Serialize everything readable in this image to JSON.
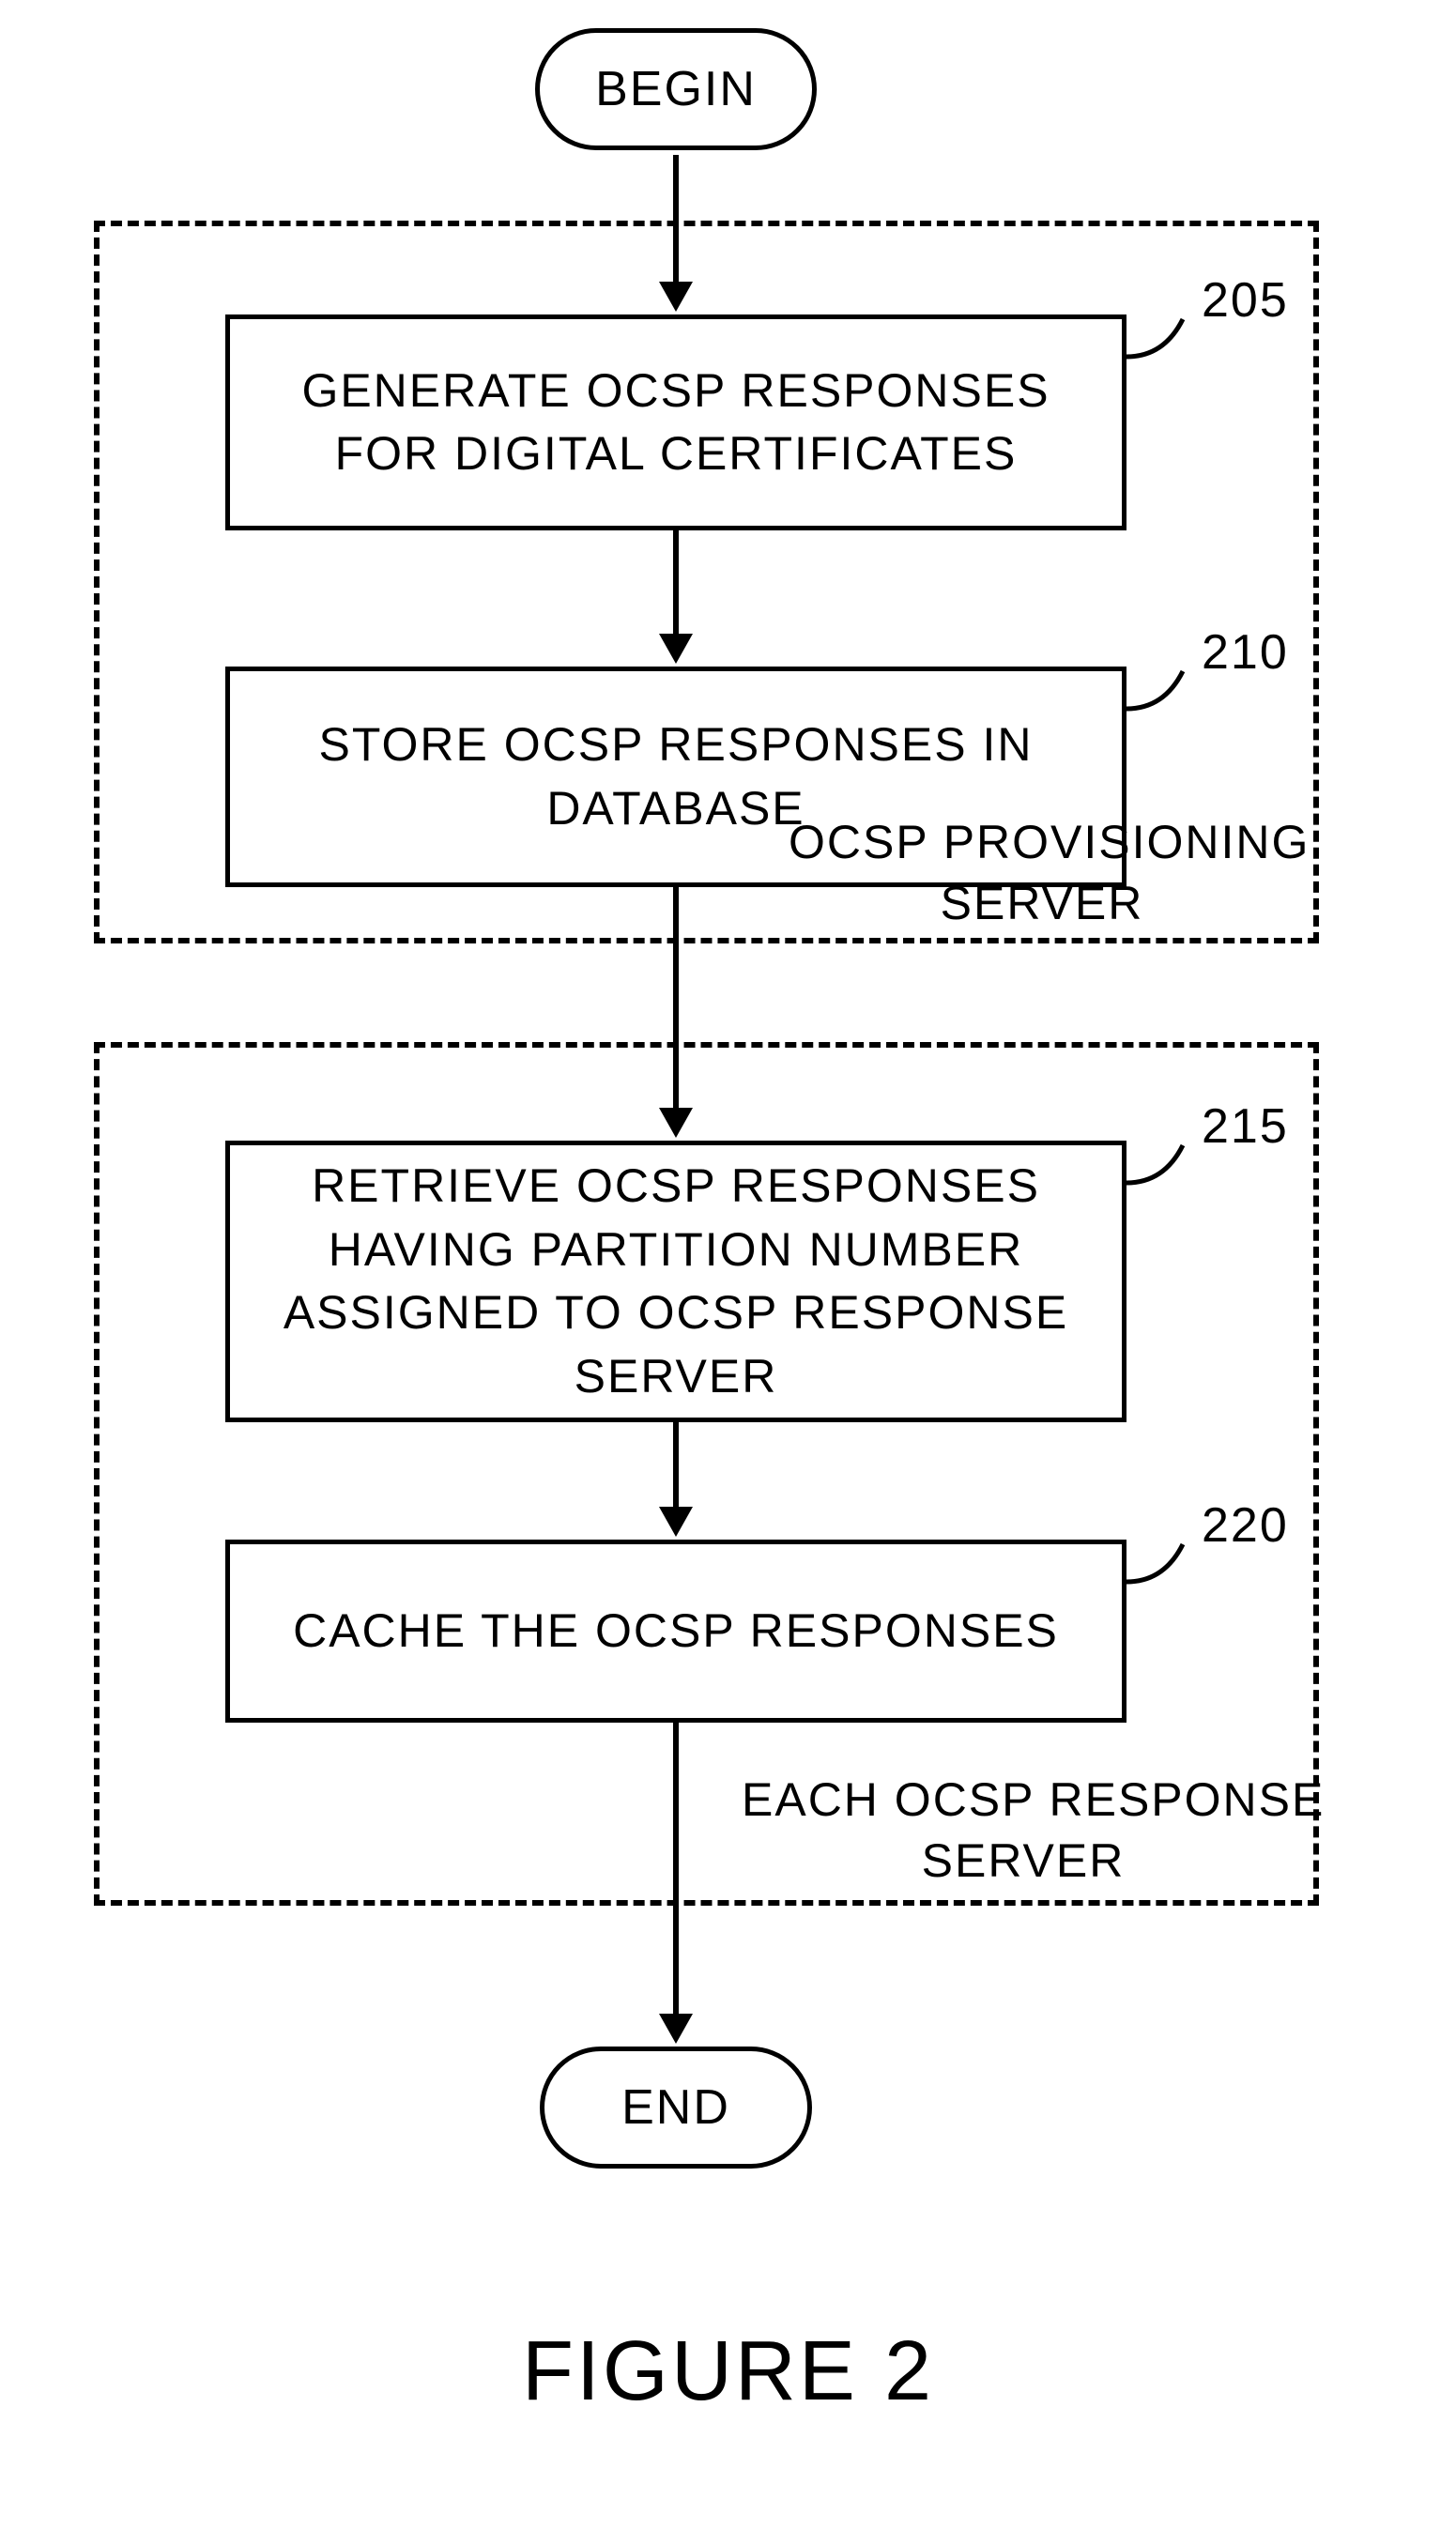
{
  "chart_data": {
    "type": "flowchart",
    "title": "FIGURE 2",
    "nodes": [
      {
        "id": "begin",
        "type": "terminator",
        "label": "BEGIN"
      },
      {
        "id": "205",
        "type": "process",
        "label": "GENERATE OCSP RESPONSES FOR\nDIGITAL CERTIFICATES",
        "ref": "205",
        "group": "provisioning"
      },
      {
        "id": "210",
        "type": "process",
        "label": "STORE OCSP RESPONSES IN\nDATABASE",
        "ref": "210",
        "group": "provisioning"
      },
      {
        "id": "215",
        "type": "process",
        "label": "RETRIEVE OCSP RESPONSES\nHAVING PARTITION NUMBER\nASSIGNED TO OCSP RESPONSE\nSERVER",
        "ref": "215",
        "group": "response"
      },
      {
        "id": "220",
        "type": "process",
        "label": "CACHE THE OCSP RESPONSES",
        "ref": "220",
        "group": "response"
      },
      {
        "id": "end",
        "type": "terminator",
        "label": "END"
      }
    ],
    "edges": [
      [
        "begin",
        "205"
      ],
      [
        "205",
        "210"
      ],
      [
        "210",
        "215"
      ],
      [
        "215",
        "220"
      ],
      [
        "220",
        "end"
      ]
    ],
    "groups": [
      {
        "id": "provisioning",
        "label": "OCSP PROVISIONING\nSERVER"
      },
      {
        "id": "response",
        "label": "EACH OCSP RESPONSE\nSERVER"
      }
    ]
  },
  "terminator": {
    "begin": "BEGIN",
    "end": "END"
  },
  "steps": {
    "s205": {
      "text": "GENERATE OCSP RESPONSES FOR DIGITAL CERTIFICATES",
      "ref": "205"
    },
    "s210": {
      "text": "STORE OCSP RESPONSES IN DATABASE",
      "ref": "210"
    },
    "s215": {
      "text": "RETRIEVE OCSP RESPONSES HAVING PARTITION NUMBER ASSIGNED TO OCSP RESPONSE SERVER",
      "ref": "215"
    },
    "s220": {
      "text": "CACHE THE OCSP RESPONSES",
      "ref": "220"
    }
  },
  "groups": {
    "provisioning": "OCSP PROVISIONING\nSERVER",
    "response": "EACH OCSP RESPONSE\nSERVER"
  },
  "title": "FIGURE 2"
}
